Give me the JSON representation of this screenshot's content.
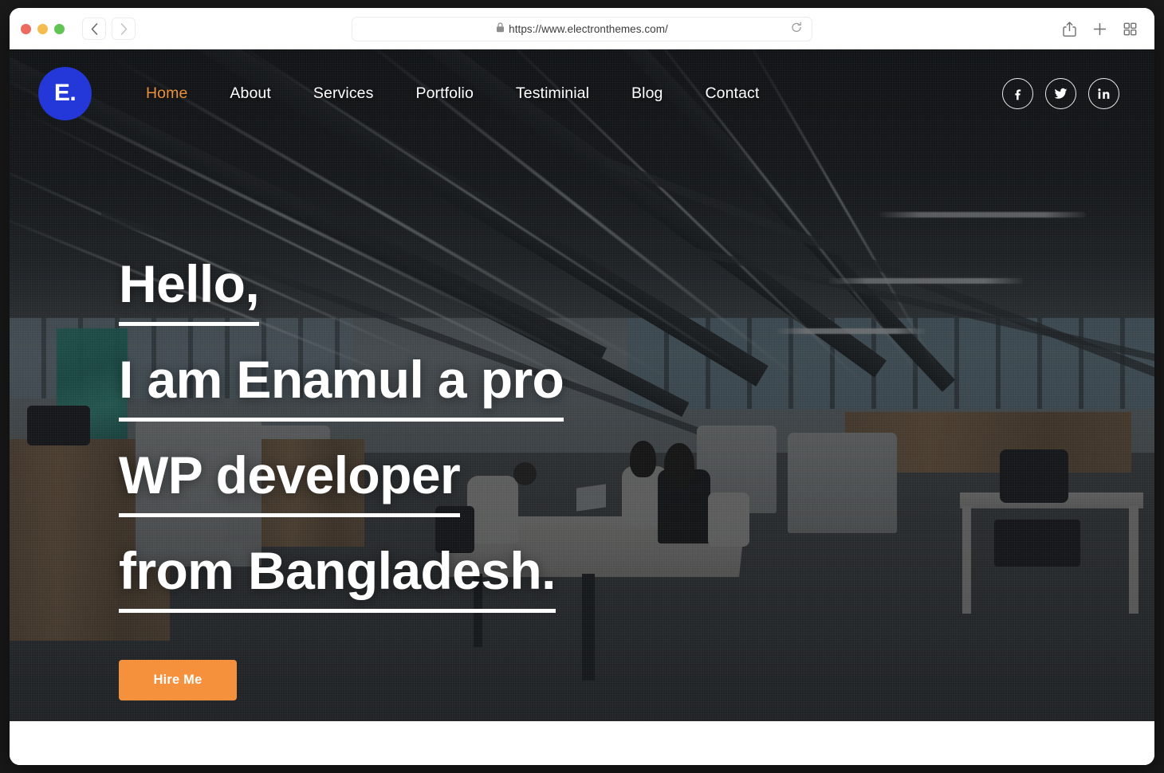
{
  "browser": {
    "traffic_lights": [
      "close",
      "minimize",
      "zoom"
    ],
    "back_label": "‹",
    "forward_label": "›",
    "url": "https://www.electronthemes.com/",
    "lock_icon": "lock-icon",
    "reload_icon": "reload-icon",
    "share_icon": "share-icon",
    "new_tab_icon": "plus-icon",
    "tab_overview_icon": "tab-grid-icon"
  },
  "site": {
    "logo_text": "E.",
    "logo_color": "#2438d9",
    "nav": [
      {
        "label": "Home",
        "active": true
      },
      {
        "label": "About",
        "active": false
      },
      {
        "label": "Services",
        "active": false
      },
      {
        "label": "Portfolio",
        "active": false
      },
      {
        "label": "Testiminial",
        "active": false
      },
      {
        "label": "Blog",
        "active": false
      },
      {
        "label": "Contact",
        "active": false
      }
    ],
    "active_color": "#e8903c",
    "social": [
      {
        "name": "facebook",
        "label": "f"
      },
      {
        "name": "twitter",
        "label": "t"
      },
      {
        "name": "linkedin",
        "label": "in"
      }
    ],
    "hero": {
      "lines": [
        "Hello,",
        "I am Enamul a pro",
        "WP developer",
        "from Bangladesh."
      ],
      "cta_label": "Hire Me",
      "cta_color": "#f5913c",
      "text_color": "#ffffff"
    }
  }
}
